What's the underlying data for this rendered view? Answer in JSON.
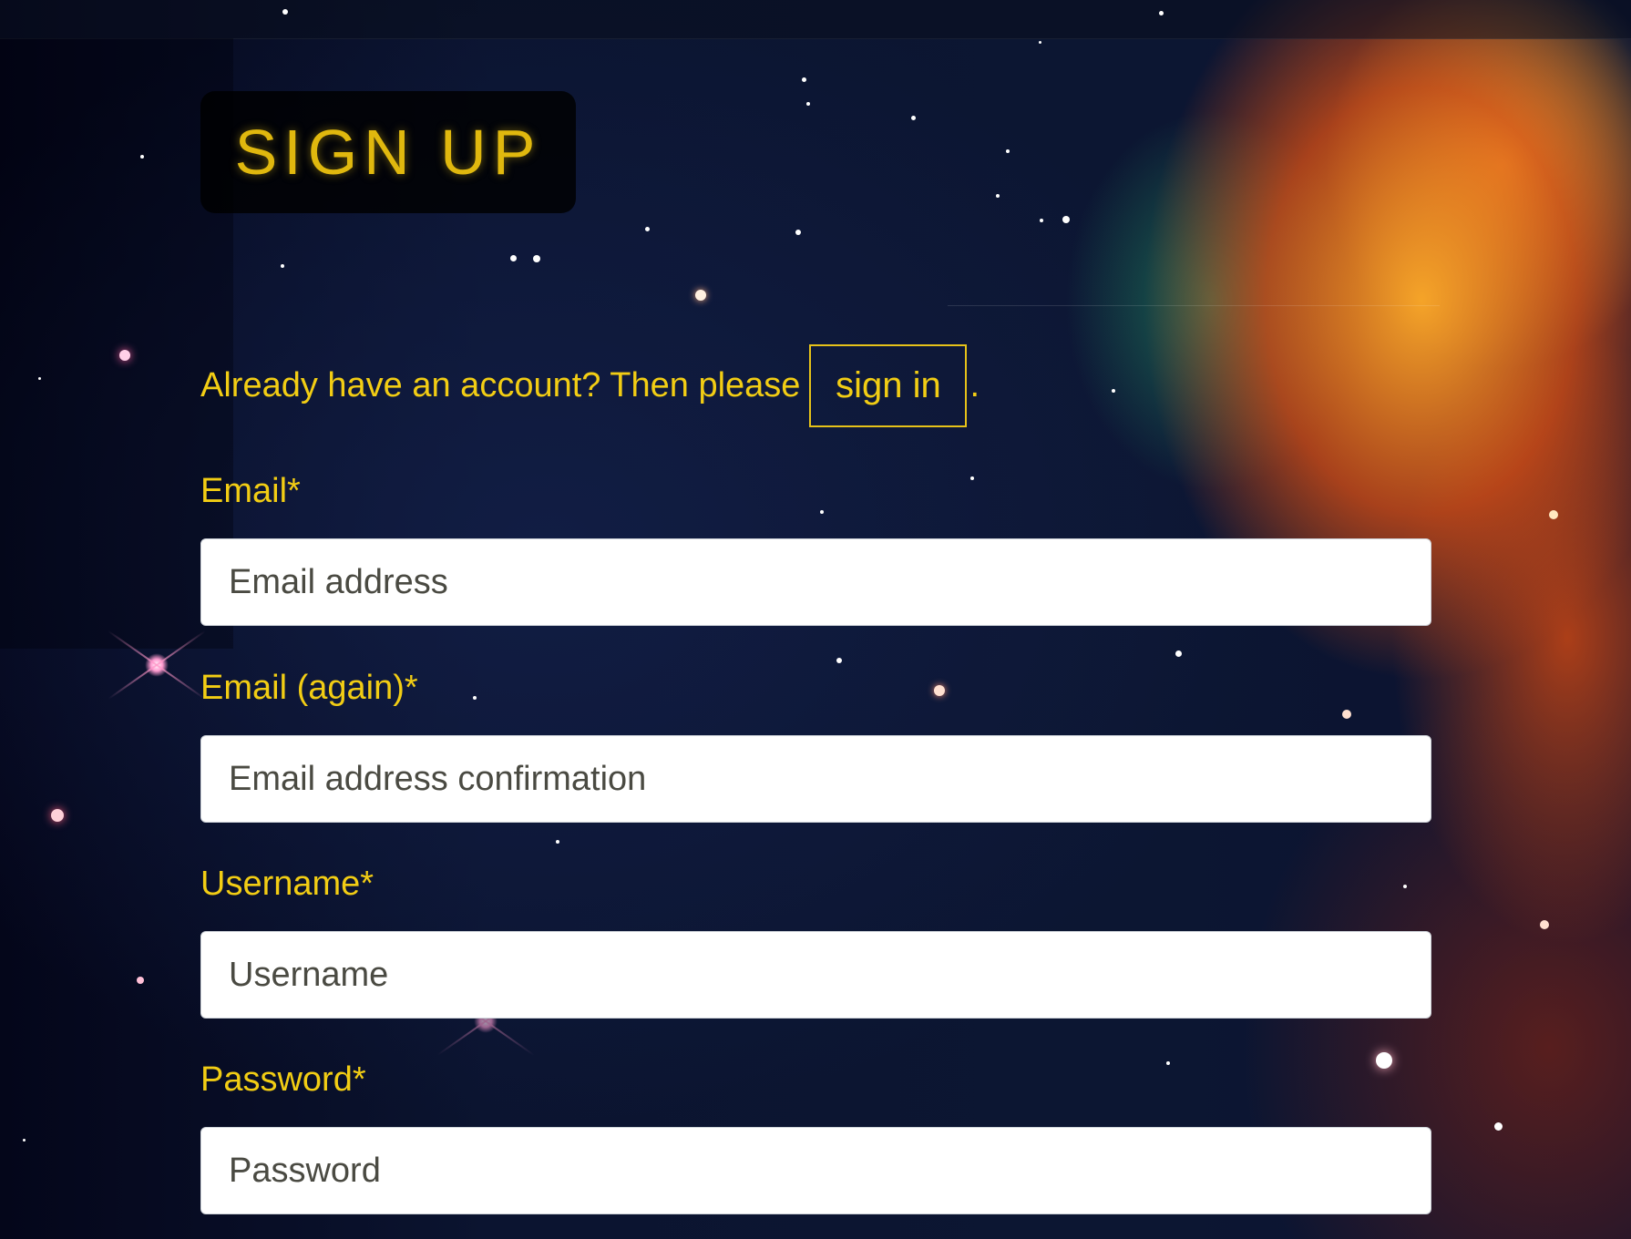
{
  "page": {
    "title": "SIGN UP"
  },
  "signin": {
    "prompt": "Already have an account? Then please",
    "link_label": "sign in",
    "suffix": "."
  },
  "form": {
    "email": {
      "label": "Email*",
      "placeholder": "Email address"
    },
    "email_again": {
      "label": "Email (again)*",
      "placeholder": "Email address confirmation"
    },
    "username": {
      "label": "Username*",
      "placeholder": "Username"
    },
    "password": {
      "label": "Password*",
      "placeholder": "Password"
    }
  },
  "colors": {
    "accent_yellow": "#f2cd14",
    "title_box": "#000000",
    "input_background": "#ffffff"
  }
}
